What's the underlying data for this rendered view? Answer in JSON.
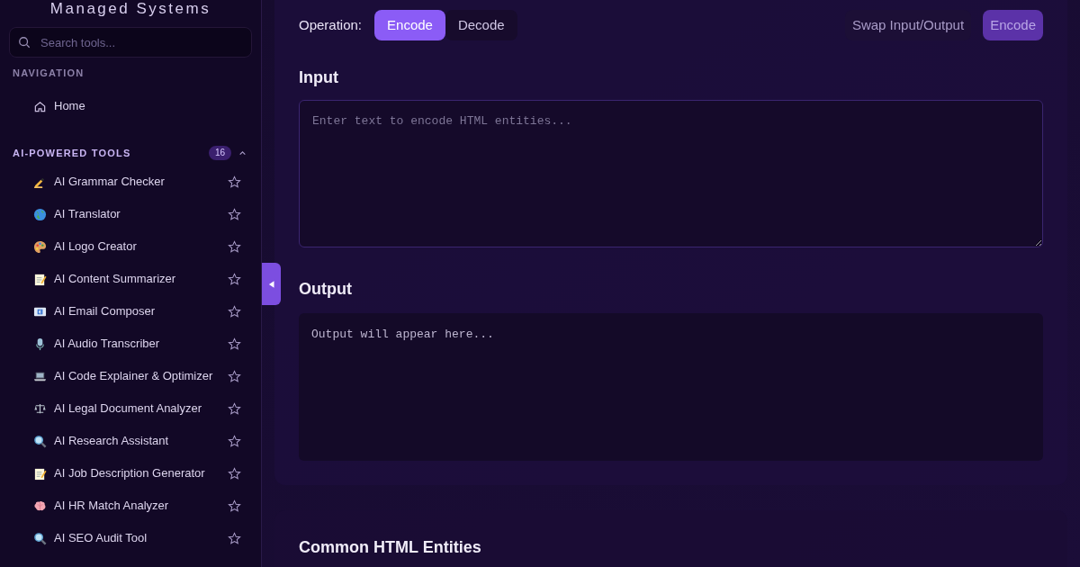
{
  "sidebar": {
    "brand": "Managed Systems",
    "search": {
      "placeholder": "Search tools..."
    },
    "sections": [
      {
        "title": "NAVIGATION",
        "items": [
          {
            "label": "Home",
            "kind": "home"
          }
        ]
      },
      {
        "title": "AI-POWERED TOOLS",
        "count": "16",
        "expanded": true,
        "items": [
          {
            "label": "AI Grammar Checker",
            "kind": "pen",
            "favorite": false
          },
          {
            "label": "AI Translator",
            "kind": "globe",
            "favorite": false
          },
          {
            "label": "AI Logo Creator",
            "kind": "palette",
            "favorite": false
          },
          {
            "label": "AI Content Summarizer",
            "kind": "memo",
            "favorite": false
          },
          {
            "label": "AI Email Composer",
            "kind": "email",
            "favorite": false
          },
          {
            "label": "AI Audio Transcriber",
            "kind": "mic",
            "favorite": false
          },
          {
            "label": "AI Code Explainer & Optimizer",
            "kind": "laptop",
            "favorite": false
          },
          {
            "label": "AI Legal Document Analyzer",
            "kind": "scales",
            "favorite": false
          },
          {
            "label": "AI Research Assistant",
            "kind": "magnifier",
            "favorite": false
          },
          {
            "label": "AI Job Description Generator",
            "kind": "memo",
            "favorite": false
          },
          {
            "label": "AI HR Match Analyzer",
            "kind": "brain",
            "favorite": false
          },
          {
            "label": "AI SEO Audit Tool",
            "kind": "magnifier",
            "favorite": false
          }
        ]
      }
    ]
  },
  "main": {
    "operation_label": "Operation:",
    "operations": [
      {
        "label": "Encode",
        "selected": true
      },
      {
        "label": "Decode",
        "selected": false
      }
    ],
    "actions": [
      {
        "label": "Swap Input/Output",
        "kind": "secondary"
      },
      {
        "label": "Encode",
        "kind": "primary"
      }
    ],
    "input": {
      "heading": "Input",
      "placeholder": "Enter text to encode HTML entities..."
    },
    "output": {
      "heading": "Output",
      "placeholder": "Output will appear here..."
    },
    "entities_heading": "Common HTML Entities"
  }
}
